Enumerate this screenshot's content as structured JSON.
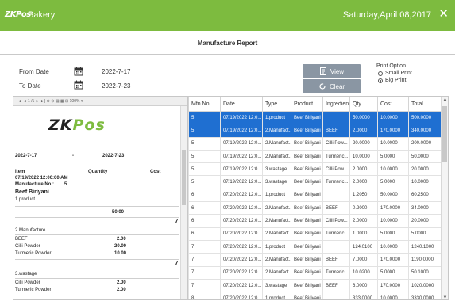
{
  "titlebar": {
    "logo": "ZKPos",
    "app_name": "Bakery",
    "date": "Saturday,April 08,2017",
    "close": "✕",
    "bg_color": "#7dbb3f"
  },
  "report": {
    "title": "Manufacture Report"
  },
  "filters": {
    "from_label": "From Date",
    "from_value": "2022-7-17",
    "to_label": "To Date",
    "to_value": "2022-7-23",
    "calendar_icon": "calendar-icon"
  },
  "buttons": {
    "view": "View",
    "clear": "Clear"
  },
  "print_option": {
    "label": "Print Option",
    "small": "Small Print",
    "big": "Big Print",
    "selected": "big"
  },
  "preview": {
    "toolbar": "|◄  ◄  1 /1 ►  ►|    ⊕  ⊖    ▤  ▦  ⊞   100%   ▾",
    "logo_main": "ZK",
    "logo_accent": "Pos",
    "date_from": "2022-7-17",
    "date_sep": "-",
    "date_to": "2022-7-23",
    "col_item": "Item",
    "col_qty": "Quantity",
    "col_cost": "Cost",
    "entry_date": "07/19/2022 12:00:00 AM",
    "manufacture_no": "Manufacture No :",
    "manufacture_no_value": "5",
    "product_name": "Beef Biriyani",
    "section1": "1.product",
    "section1_total": "50.00",
    "side_mark1": "7",
    "section2": "2.Manufacture",
    "s2_rows": [
      {
        "item": "BEEF",
        "qty": "2.00"
      },
      {
        "item": "Cilli Powder",
        "qty": "20.00"
      },
      {
        "item": "Turmeric Powder",
        "qty": "10.00"
      }
    ],
    "side_mark2": "7",
    "section3": "3.wastage",
    "s3_rows": [
      {
        "item": "Cilli Powder",
        "qty": "2.00"
      },
      {
        "item": "Turmeric Powder",
        "qty": "2.00"
      }
    ]
  },
  "grid": {
    "columns": [
      "Mfn No",
      "Date",
      "Type",
      "Product",
      "Ingredien",
      "Qty",
      "Cost",
      "Total"
    ],
    "rows": [
      [
        "5",
        "07/19/2022 12:0...",
        "1.product",
        "Beef Biriyani",
        "",
        "50.0000",
        "10.0000",
        "500.0000"
      ],
      [
        "5",
        "07/19/2022 12:0...",
        "2.Manufact...",
        "Beef Biriyani",
        "BEEF",
        "2.0000",
        "170.0000",
        "340.0000"
      ],
      [
        "5",
        "07/19/2022 12:0...",
        "2.Manufact...",
        "Beef Biriyani",
        "Cilli Pow...",
        "20.0000",
        "10.0000",
        "200.0000"
      ],
      [
        "5",
        "07/19/2022 12:0...",
        "2.Manufact...",
        "Beef Biriyani",
        "Turmeric...",
        "10.0000",
        "5.0000",
        "50.0000"
      ],
      [
        "5",
        "07/19/2022 12:0...",
        "3.wastage",
        "Beef Biriyani",
        "Cilli Pow...",
        "2.0000",
        "10.0000",
        "20.0000"
      ],
      [
        "5",
        "07/19/2022 12:0...",
        "3.wastage",
        "Beef Biriyani",
        "Turmeric...",
        "2.0000",
        "5.0000",
        "10.0000"
      ],
      [
        "6",
        "07/20/2022 12:0...",
        "1.product",
        "Beef Biriyani",
        "",
        "1.2050",
        "50.0000",
        "60.2500"
      ],
      [
        "6",
        "07/20/2022 12:0...",
        "2.Manufact...",
        "Beef Biriyani",
        "BEEF",
        "0.2000",
        "170.0000",
        "34.0000"
      ],
      [
        "6",
        "07/20/2022 12:0...",
        "2.Manufact...",
        "Beef Biriyani",
        "Cilli Pow...",
        "2.0000",
        "10.0000",
        "20.0000"
      ],
      [
        "6",
        "07/20/2022 12:0...",
        "2.Manufact...",
        "Beef Biriyani",
        "Turmeric...",
        "1.0000",
        "5.0000",
        "5.0000"
      ],
      [
        "7",
        "07/20/2022 12:0...",
        "1.product",
        "Beef Biriyani",
        "",
        "124.0100",
        "10.0000",
        "1240.1000"
      ],
      [
        "7",
        "07/20/2022 12:0...",
        "2.Manufact...",
        "Beef Biriyani",
        "BEEF",
        "7.0000",
        "170.0000",
        "1190.0000"
      ],
      [
        "7",
        "07/20/2022 12:0...",
        "2.Manufact...",
        "Beef Biriyani",
        "Turmeric...",
        "10.0200",
        "5.0000",
        "50.1000"
      ],
      [
        "7",
        "07/20/2022 12:0...",
        "3.wastage",
        "Beef Biriyani",
        "BEEF",
        "6.0000",
        "170.0000",
        "1020.0000"
      ],
      [
        "8",
        "07/20/2022 12:0...",
        "1.product",
        "Beef Biriyani",
        "",
        "333.0000",
        "10.0000",
        "3330.0000"
      ],
      [
        "8",
        "07/20/2022 12:0...",
        "2.Manufact...",
        "Beef Biriyani",
        "asafoetida",
        "10.0000",
        "110.0000",
        "1100.0000"
      ]
    ],
    "selected_rows": 2
  }
}
